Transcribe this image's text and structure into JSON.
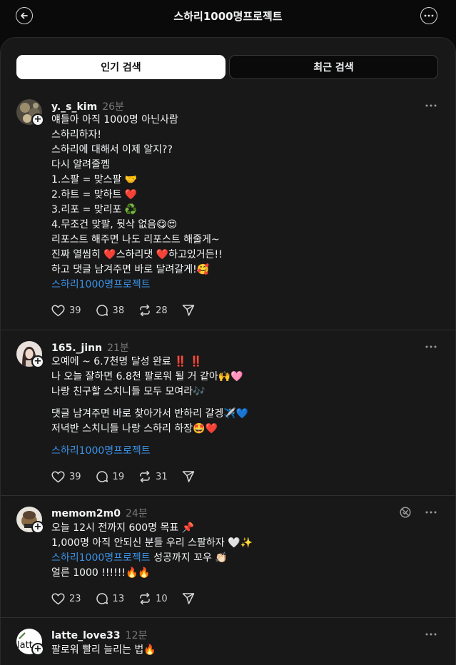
{
  "header": {
    "title": "스하리1000명프로젝트",
    "back_icon": "arrow-left-icon",
    "more_icon": "more-horizontal-icon"
  },
  "tabs": [
    {
      "label": "인기 검색",
      "selected": true
    },
    {
      "label": "최근 검색",
      "selected": false
    }
  ],
  "colors": {
    "background": "#0a0a0a",
    "panel": "#181818",
    "hashtag": "#3b92e6",
    "heart": "#e2243f"
  },
  "posts": [
    {
      "username": "y._s_kim",
      "time": "26분",
      "lines": [
        "얘들아 아직 1000명 아닌사람",
        "스하리하자!",
        "스하리에 대해서 이제 알지??",
        "다시 알려줄껨",
        "1.스팔 = 맞스팔 🤝",
        "2.하트 = 맞하트 ❤️",
        "3.리포 = 맞리포 ♻️",
        "4.무조건 맞팔, 뒷삭 없음😋😍",
        "리포스트 해주면 나도 리포스트 해줄게~",
        "진짜 열씸히 ❤️스하리댓 ❤️하고있거든!!",
        "하고 댓글 남겨주면 바로 달려갈게!🥰"
      ],
      "hashtag": "스하리1000명프로젝트",
      "likes": "39",
      "comments": "38",
      "reposts": "28"
    },
    {
      "username": "165._jinn",
      "time": "21분",
      "lines": [
        "오예에 ~ 6.7천명 달성 완료 ‼️ ‼️",
        "나 오늘 잘하면 6.8천 팔로워 될 거 같아🙌🩷",
        "나랑 친구할 스치니들 모두 모여라🎶",
        "",
        "댓글 남겨주면 바로 찾아가서 반하리 갈겡✈️💙",
        "저녁반 스치니들 나랑 스하리 하장🤩❤️"
      ],
      "hashtag": "스하리1000명프로젝트",
      "likes": "39",
      "comments": "19",
      "reposts": "31"
    },
    {
      "username": "memom2m0",
      "time": "24분",
      "lines": [
        "오늘 12시 전까지 600명 목표 📌",
        "1,000명 아직 안되신 분들 우리 스팔하자 🤍✨"
      ],
      "hashtag_line": {
        "hashtag": "스하리1000명프로젝트",
        "rest": " 성공까지 꼬우 👏🏻"
      },
      "last_line": "얼른 1000 !!!!!!🔥🔥",
      "likes": "23",
      "comments": "13",
      "reposts": "10"
    },
    {
      "username": "latte_love33",
      "time": "12분",
      "avatar_text": "latt",
      "lines": [
        "팔로워 빨리 늘리는 법🔥"
      ]
    }
  ]
}
